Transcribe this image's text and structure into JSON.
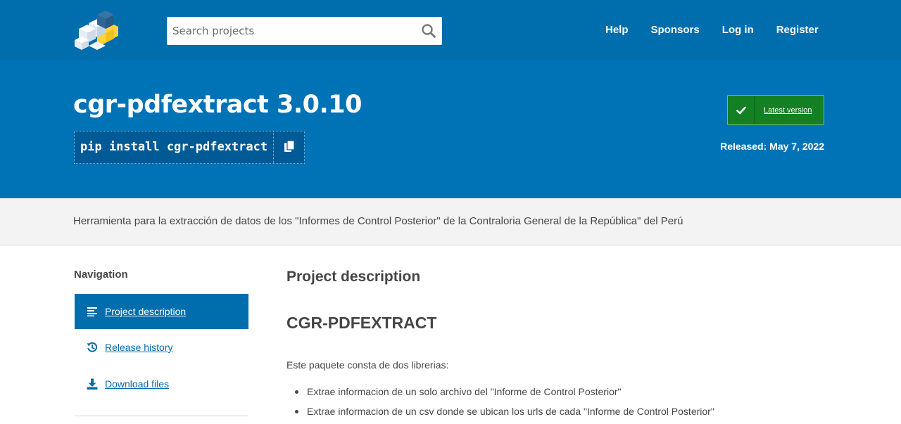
{
  "header": {
    "logo_icon": "pypi-logo-icon",
    "search": {
      "placeholder": "Search projects",
      "value": "",
      "icon": "search-icon"
    },
    "nav": [
      {
        "label": "Help"
      },
      {
        "label": "Sponsors"
      },
      {
        "label": "Log in"
      },
      {
        "label": "Register"
      }
    ]
  },
  "banner": {
    "title": "cgr-pdfextract 3.0.10",
    "pip_command": "pip install cgr-pdfextract",
    "copy_icon": "copy-icon",
    "latest_version_label": "Latest version",
    "latest_icon": "checkmark-icon",
    "released": "Released: May 7, 2022"
  },
  "summary": "Herramienta para la extracción de datos de los \"Informes de Control Posterior\" de la Contraloria General de la República\" del Perú",
  "sidebar": {
    "heading": "Navigation",
    "items": [
      {
        "label": "Project description",
        "icon": "align-left-icon",
        "active": true
      },
      {
        "label": "Release history",
        "icon": "history-icon",
        "active": false
      },
      {
        "label": "Download files",
        "icon": "download-icon",
        "active": false
      }
    ]
  },
  "content": {
    "section_title": "Project description",
    "heading": "CGR-PDFEXTRACT",
    "intro": "Este paquete consta de dos librerias:",
    "bullets": [
      "Extrae informacion de un solo archivo del \"Informe de Control Posterior\"",
      "Extrae informacion de un csv donde se ubican los urls de cada \"Informe de Control Posterior\""
    ]
  },
  "colors": {
    "header_blue": "#006dad",
    "banner_blue": "#0073b7",
    "latest_green": "#148024",
    "summary_grey": "#f3f3f3"
  }
}
